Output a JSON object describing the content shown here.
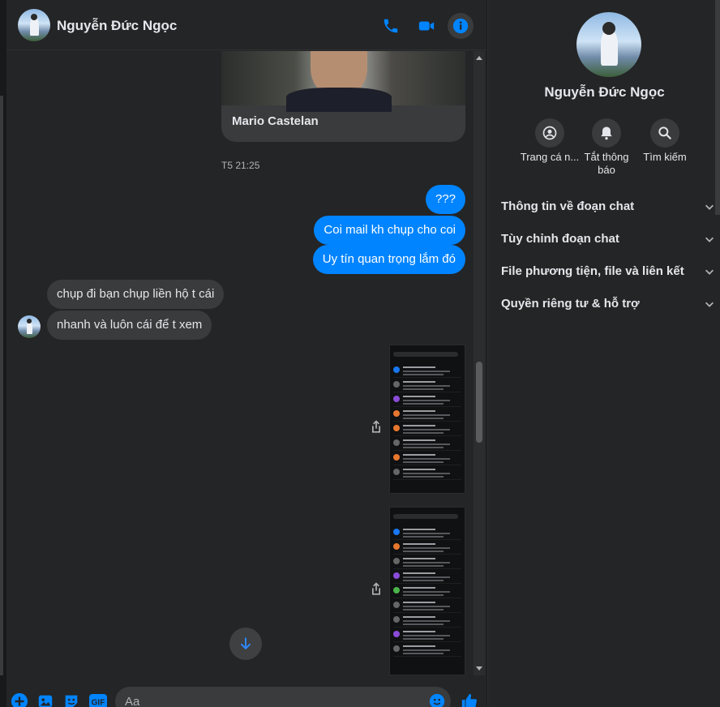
{
  "conversation": {
    "contact_name": "Nguyễn Đức Ngọc"
  },
  "header": {
    "call_icon": "phone-icon",
    "video_icon": "video-camera-icon",
    "info_icon": "info-icon"
  },
  "messages": {
    "shared_card_title": "Mario Castelan",
    "timestamp": "T5 21:25",
    "outgoing": [
      "???",
      "Coi mail kh chụp cho coi",
      "Uy tín quan trọng lắm đó"
    ],
    "incoming": [
      "chụp đi bạn chụp liền hộ t cái",
      "nhanh và luôn cái để t xem"
    ]
  },
  "composer": {
    "placeholder": "Aa",
    "gif_label": "GIF"
  },
  "sidebar": {
    "name": "Nguyễn Đức Ngọc",
    "actions": [
      {
        "label": "Trang cá n...",
        "icon": "profile-icon"
      },
      {
        "label": "Tắt thông báo",
        "icon": "bell-icon"
      },
      {
        "label": "Tìm kiếm",
        "icon": "search-icon"
      }
    ],
    "sections": [
      "Thông tin về đoạn chat",
      "Tùy chỉnh đoạn chat",
      "File phương tiện, file và liên kết",
      "Quyền riêng tư & hỗ trợ"
    ]
  },
  "colors": {
    "accent": "#0084ff",
    "background": "#242526",
    "bubble_incoming": "#3a3b3c"
  }
}
